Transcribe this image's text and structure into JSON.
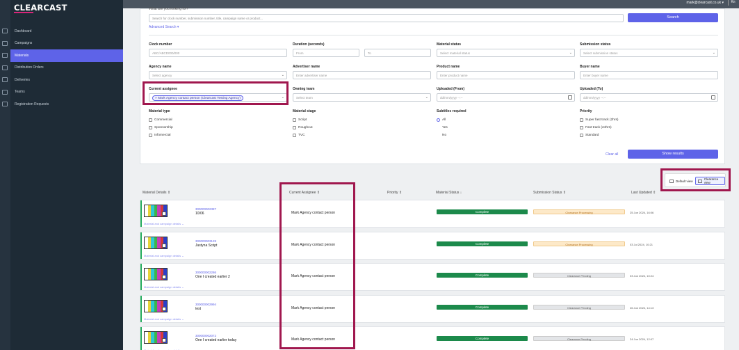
{
  "brand": {
    "name": "CLEARCAST"
  },
  "topbar": {
    "user_email": "mark@clearcast.co.uk",
    "user_menu": "▾",
    "corner": "Kn"
  },
  "nav": [
    {
      "label": "Dashboard",
      "icon": "laptop-icon"
    },
    {
      "label": "Campaigns",
      "icon": "megaphone-icon"
    },
    {
      "label": "Materials",
      "icon": "film-icon",
      "active": true
    },
    {
      "label": "Distribution Orders",
      "icon": "document-icon"
    },
    {
      "label": "Deliveries",
      "icon": "upload-icon"
    },
    {
      "label": "Teams",
      "icon": "team-icon"
    },
    {
      "label": "Registration Requests",
      "icon": "user-group-icon"
    }
  ],
  "search": {
    "cut_label": "What are you looking for?",
    "placeholder": "Search for clock number, submission number, title, campaign name or product...",
    "button": "Search",
    "advanced": "Advanced Search ▾"
  },
  "filters": {
    "clock_number": {
      "label": "Clock number",
      "placeholder": "ABC/ABCD000/000"
    },
    "duration": {
      "label": "Duration (seconds)",
      "from": "From",
      "to": "To"
    },
    "material_status": {
      "label": "Material status",
      "placeholder": "Select material status"
    },
    "submission_status": {
      "label": "Submission status",
      "placeholder": "Select submission status"
    },
    "agency_name": {
      "label": "Agency name",
      "placeholder": "Select agency"
    },
    "advertiser_name": {
      "label": "Advertiser name",
      "placeholder": "Enter advertiser name"
    },
    "product_name": {
      "label": "Product name",
      "placeholder": "Enter product name"
    },
    "buyer_name": {
      "label": "Buyer name",
      "placeholder": "Enter buyer name"
    },
    "current_assignee": {
      "label": "Current assignee",
      "chip": "× Mark Agency contact person (Clearcast Testing Agency)"
    },
    "owning_team": {
      "label": "Owning team",
      "placeholder": "Select team"
    },
    "uploaded_from": {
      "label": "Uploaded (From)",
      "placeholder": "dd/mm/yyyy --:--"
    },
    "uploaded_to": {
      "label": "Uploaded (To)",
      "placeholder": "dd/mm/yyyy --:--"
    },
    "material_type": {
      "label": "Material type",
      "options": [
        "Commercial",
        "Sponsorship",
        "Infomercial"
      ]
    },
    "material_stage": {
      "label": "Material stage",
      "options": [
        "Script",
        "Roughcut",
        "TVC"
      ]
    },
    "subtitles": {
      "label": "Subtitles required",
      "options": [
        "All",
        "Yes",
        "No"
      ],
      "selected": "All"
    },
    "priority": {
      "label": "Priority",
      "options": [
        "Super fast track (2hrs)",
        "Fast track (24hrs)",
        "Standard"
      ]
    },
    "clear_all": "Clear all",
    "show_results": "Show results"
  },
  "view_toggle": {
    "default": "Default view",
    "clearance": "Clearance view"
  },
  "table": {
    "headers": {
      "material": "Material Details ⇕",
      "assignee": "Current Assignee ⇕",
      "priority": "Priority ⇕",
      "material_status": "Material Status ↓",
      "submission_status": "Submission Status ⇕",
      "last_updated": "Last Updated ⇕"
    },
    "details_link": "Material and campaign details ⌄",
    "rows": [
      {
        "clock": "300000002387",
        "title": "10/06",
        "assignee": "Mark Agency contact person",
        "status": "Complete",
        "submission": "Clearance Processing",
        "sub_kind": "proc",
        "updated": "25 Jun 2024, 16:06"
      },
      {
        "clock": "300000003128",
        "title": "Justyna Script",
        "assignee": "Mark Agency contact person",
        "status": "Complete",
        "submission": "Clearance Processing",
        "sub_kind": "proc",
        "updated": "03 Jul 2024, 10:21"
      },
      {
        "clock": "300000002286",
        "title": "One I created earlier 2",
        "assignee": "Mark Agency contact person",
        "status": "Complete",
        "submission": "Clearance Pending",
        "sub_kind": "pend",
        "updated": "03 Jun 2024, 10:24"
      },
      {
        "clock": "300000002994",
        "title": "test",
        "assignee": "Mark Agency contact person",
        "status": "Complete",
        "submission": "Clearance Pending",
        "sub_kind": "pend",
        "updated": "26 Jun 2024, 14:13"
      },
      {
        "clock": "300000002072",
        "title": "One I created earlier today",
        "assignee": "Mark Agency contact person",
        "status": "Complete",
        "submission": "Clearance Pending",
        "sub_kind": "pend",
        "updated": "24 Jun 2024, 12:07"
      }
    ]
  },
  "colors": {
    "accent": "#5e63e8",
    "highlight": "#a0174e",
    "complete": "#1c8a4b"
  }
}
